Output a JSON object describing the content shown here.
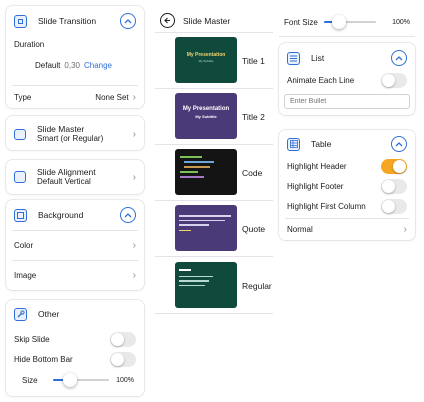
{
  "transition": {
    "title": "Slide Transition",
    "duration_label": "Duration",
    "default_label": "Default",
    "duration_value": "0,30",
    "change_label": "Change",
    "type_label": "Type",
    "type_value": "None Set"
  },
  "slide_master": {
    "title": "Slide Master",
    "value": "Smart (or Regular)"
  },
  "slide_alignment": {
    "title": "Slide Alignment",
    "value": "Default Vertical"
  },
  "background": {
    "title": "Background",
    "color_label": "Color",
    "image_label": "Image"
  },
  "other": {
    "title": "Other",
    "skip_slide": "Skip Slide",
    "hide_bottom_bar": "Hide Bottom Bar",
    "size_label": "Size",
    "size_value": "100%",
    "size_fraction": 0.3
  },
  "master_list": {
    "title": "Slide Master",
    "items": [
      {
        "label": "Title 1",
        "thumb_title": "My Presentation",
        "thumb_sub": "My Subtitle",
        "bg": "#0f4a3c"
      },
      {
        "label": "Title 2",
        "thumb_title": "My Presentation",
        "thumb_sub": "My Subtitle",
        "bg": "#4b3a78"
      },
      {
        "label": "Code",
        "bg": "#141414"
      },
      {
        "label": "Quote",
        "bg": "#4b3a78"
      },
      {
        "label": "Regular",
        "bg": "#0f4a3c"
      }
    ]
  },
  "font_size": {
    "label": "Font Size",
    "value": "100%",
    "fraction": 0.28
  },
  "list": {
    "title": "List",
    "animate_label": "Animate Each Line",
    "bullet_placeholder": "Enter Bullet"
  },
  "table": {
    "title": "Table",
    "highlight_header": "Highlight Header",
    "highlight_footer": "Highlight Footer",
    "highlight_first_column": "Highlight First Column",
    "style_value": "Normal"
  },
  "colors": {
    "accent": "#2f6fd6",
    "toggle_on": "#f5a623"
  }
}
